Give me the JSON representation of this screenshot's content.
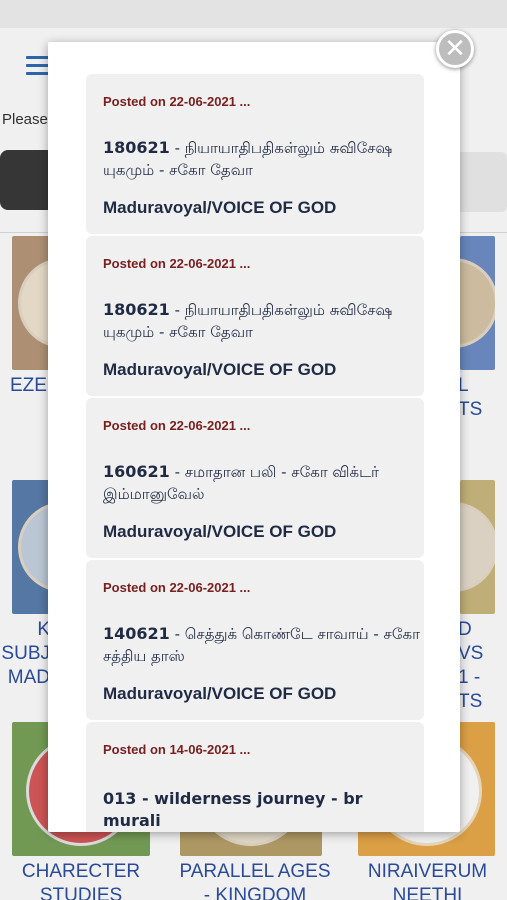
{
  "background": {
    "please_text": "Please",
    "tiles": [
      {
        "label": "EZE",
        "lines": [
          "EZE"
        ]
      },
      {
        "label": "L TS",
        "lines": [
          "L",
          "TS"
        ]
      },
      {
        "label": "K SUBJ MAD",
        "lines": [
          "K",
          "SUBJ",
          "MAD"
        ]
      },
      {
        "label": "D VS 1 - TS",
        "lines": [
          "D",
          "VS",
          "1 -",
          "TS"
        ]
      },
      {
        "label": "CHARECTER STUDIES",
        "lines": [
          "CHARECTER",
          "STUDIES"
        ]
      },
      {
        "label": "PARALLEL AGES - KINGDOM",
        "lines": [
          "PARALLEL AGES",
          "- KINGDOM"
        ]
      },
      {
        "label": "NIRAIVERUM NEETHI",
        "lines": [
          "NIRAIVERUM",
          "NEETHI"
        ]
      }
    ]
  },
  "modal": {
    "close_label": "✕",
    "items": [
      {
        "posted": "Posted on 22-06-2021 ...",
        "code": "180621",
        "title_rest": " - நியாயாதிபதிகள்லும் சுவிசேஷ யுகமும் - சகோ தேவா",
        "source": "Maduravoyal/VOICE OF GOD"
      },
      {
        "posted": "Posted on 22-06-2021 ...",
        "code": "180621",
        "title_rest": " - நியாயாதிபதிகள்லும் சுவிசேஷ யுகமும் - சகோ தேவா",
        "source": "Maduravoyal/VOICE OF GOD"
      },
      {
        "posted": "Posted on 22-06-2021 ...",
        "code": " 160621",
        "title_rest": " - சமாதான பலி - சகோ விக்டர் இம்மானுவேல்",
        "source": "Maduravoyal/VOICE OF GOD"
      },
      {
        "posted": "Posted on 22-06-2021 ...",
        "code": "140621",
        "title_rest": " - செத்துக் கொண்டே சாவாய் - சகோ சத்திய தாஸ்",
        "source": "Maduravoyal/VOICE OF GOD"
      },
      {
        "posted": "Posted on 14-06-2021 ...",
        "code": "013 - wilderness journey - br murali",
        "title_rest": "",
        "source": ""
      }
    ]
  },
  "colors": {
    "accent_blue": "#2c4fa5",
    "posted_red": "#7a1f1f",
    "card_bg": "#f0f0f0"
  }
}
